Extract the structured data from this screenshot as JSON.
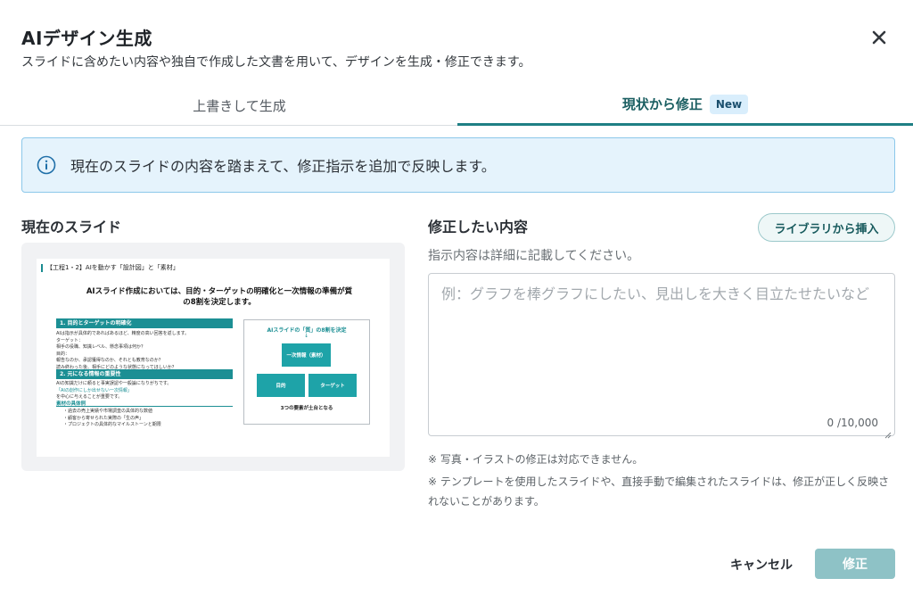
{
  "dialog": {
    "title": "AIデザイン生成",
    "subtitle": "スライドに含めたい内容や独自で作成した文書を用いて、デザインを生成・修正できます。"
  },
  "tabs": [
    {
      "label": "上書きして生成",
      "active": false
    },
    {
      "label": "現状から修正",
      "active": true,
      "badge": "New"
    }
  ],
  "info": {
    "icon": "info-icon",
    "text": "現在のスライドの内容を踏まえて、修正指示を追加で反映します。"
  },
  "left": {
    "title": "現在のスライド",
    "slide": {
      "header": "【工程1・2】AIを動かす「設計図」と「素材」",
      "headline_1": "AIスライド作成においては、目的・ターゲットの明確化と一次情報の準備が質",
      "headline_2": "の8割を決定します。",
      "section1": "1. 目的とターゲットの明確化",
      "section1_lines": [
        "AIは指示が具体的であればあるほど、精度の高い回答を返します。",
        "ターゲット：",
        "相手の役職、知識レベル、懸念事項は何か？",
        "目的：",
        "報告なのか、承認獲得なのか、それとも教育なのか？",
        "読み終わった後、相手にどのような状態になってほしいか？"
      ],
      "section2": "2. 元になる情報の重要性",
      "section2_lines": [
        "AIの知識だけに頼ると事実誤認や一般論になりがちです。",
        "「AIの創作にしか出せない一次情報」",
        "を中心に与えることが重要です。"
      ],
      "materials_label": "素材の具体例",
      "materials": [
        "・過去の売上実績や市場調査の具体的な数値",
        "・顧客から寄せられた実際の「生の声」",
        "・プロジェクトの具体的なマイルストーンと期限"
      ],
      "diagram_title": "AIスライドの「質」の8割を決定",
      "diagram_arrow": "↓",
      "block_top": "一次情報（素材）",
      "block_left": "目的",
      "block_right": "ターゲット",
      "diagram_foot": "3つの要素が土台となる"
    }
  },
  "right": {
    "title": "修正したい内容",
    "library_button": "ライブラリから挿入",
    "hint": "指示内容は詳細に記載してください。",
    "textarea_placeholder": "例：グラフを棒グラフにしたい、見出しを大きく目立たせたいなど",
    "textarea_value": "",
    "counter": "0 /10,000",
    "note1": "※ 写真・イラストの修正は対応できません。",
    "note2": "※ テンプレートを使用したスライドや、直接手動で編集されたスライドは、修正が正しく反映されないことがあります。"
  },
  "footer": {
    "cancel_label": "キャンセル",
    "submit_label": "修正"
  },
  "colors": {
    "accent": "#1f7f84",
    "submit_disabled": "#8ec2c6",
    "info_bg": "#e5f3fc",
    "info_border": "#8cc8ea"
  }
}
